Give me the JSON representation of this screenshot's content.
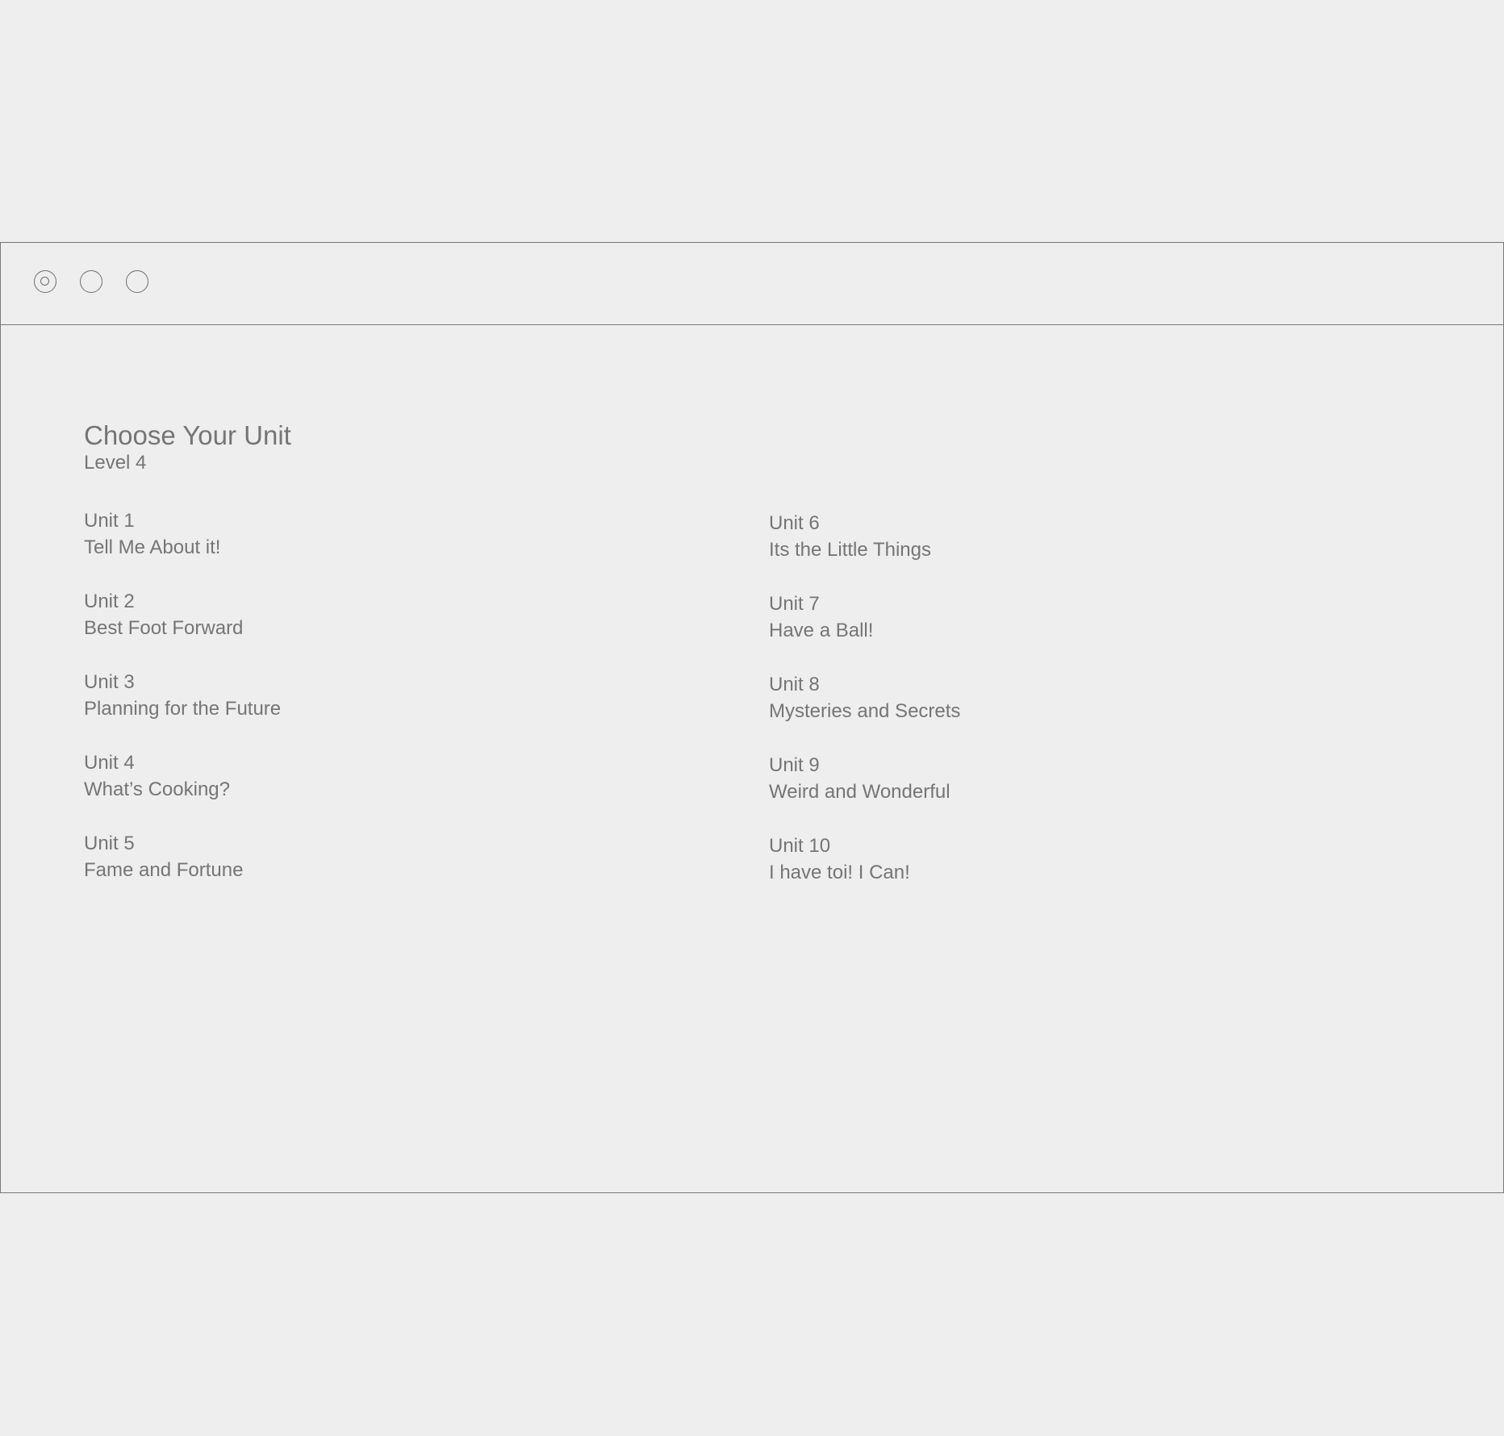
{
  "window": {
    "controls": [
      "close-icon",
      "minimize-icon",
      "maximize-icon"
    ]
  },
  "page": {
    "title": "Choose Your Unit",
    "subtitle": "Level 4"
  },
  "units_left": [
    {
      "number": "Unit 1",
      "title": "Tell Me About it!"
    },
    {
      "number": "Unit 2",
      "title": "Best Foot Forward"
    },
    {
      "number": "Unit 3",
      "title": "Planning for the Future"
    },
    {
      "number": "Unit 4",
      "title": "What’s Cooking?"
    },
    {
      "number": "Unit 5",
      "title": "Fame and Fortune"
    }
  ],
  "units_right": [
    {
      "number": "Unit 6",
      "title": "Its the Little Things"
    },
    {
      "number": "Unit 7",
      "title": "Have a Ball!"
    },
    {
      "number": "Unit 8",
      "title": "Mysteries and Secrets"
    },
    {
      "number": "Unit 9",
      "title": "Weird and Wonderful"
    },
    {
      "number": "Unit 10",
      "title": "I have toi! I Can!"
    }
  ],
  "colors": {
    "background": "#eeeeee",
    "text": "#757575",
    "border": "#777777"
  }
}
